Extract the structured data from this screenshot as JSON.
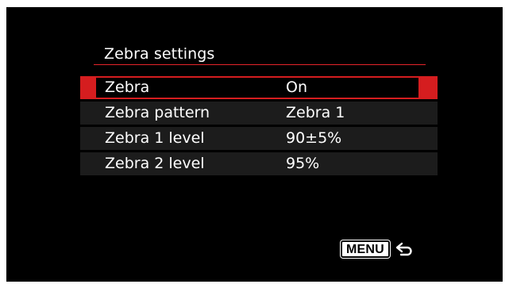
{
  "screen": {
    "title": "Zebra settings",
    "accent_color": "#e5242a",
    "selection_color": "#d51d1f"
  },
  "menu": {
    "items": [
      {
        "label": "Zebra",
        "value": "On",
        "selected": true
      },
      {
        "label": "Zebra pattern",
        "value": "Zebra 1",
        "selected": false
      },
      {
        "label": "Zebra 1 level",
        "value": "90±5%",
        "selected": false
      },
      {
        "label": "Zebra 2 level",
        "value": "95%",
        "selected": false
      }
    ]
  },
  "footer": {
    "menu_button_label": "MENU",
    "return_icon": "return-arrow-icon"
  }
}
